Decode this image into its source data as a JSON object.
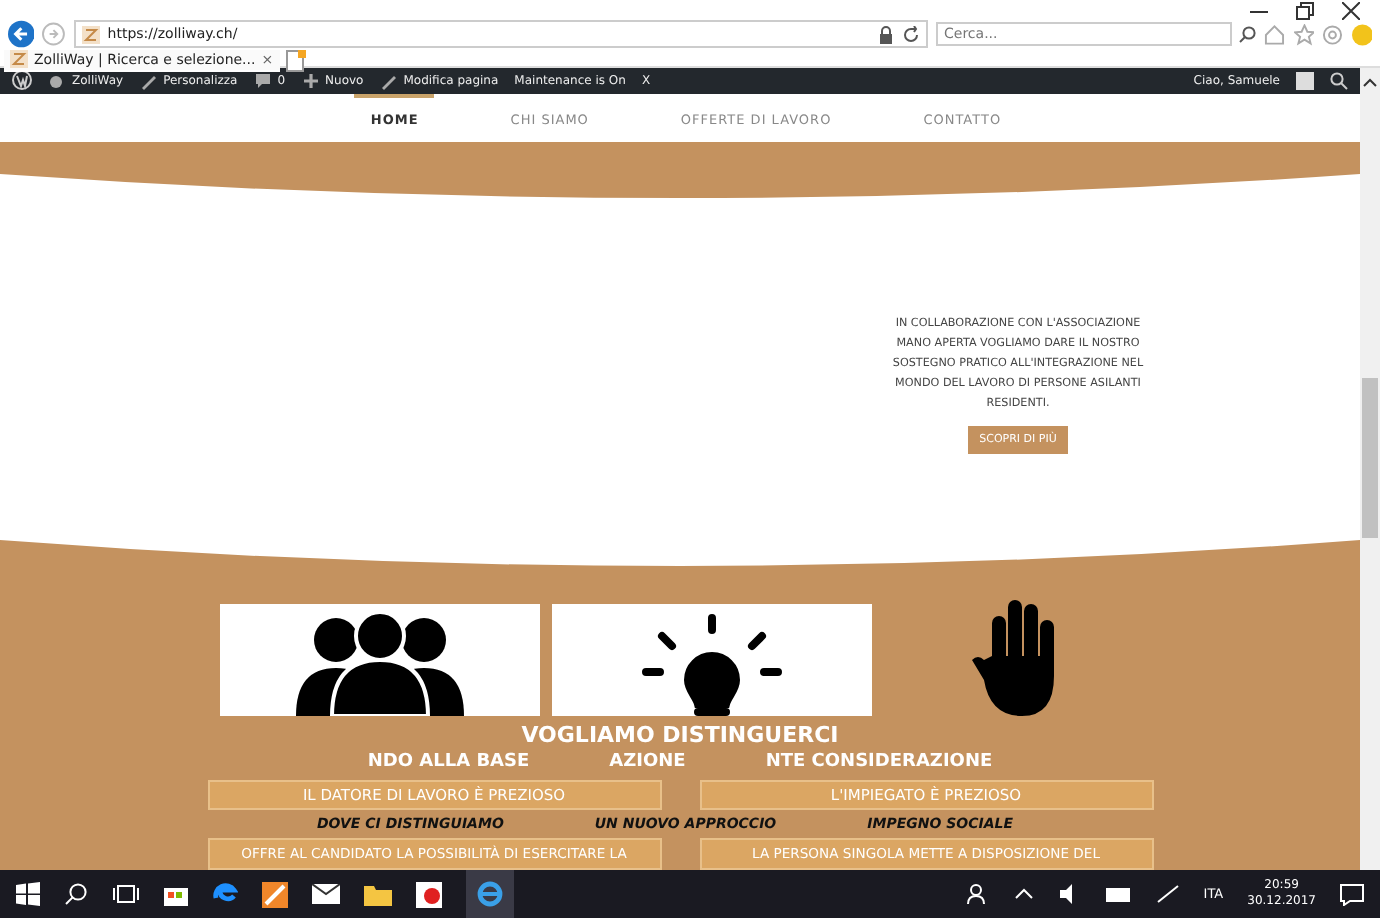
{
  "browser": {
    "address": "https://zolliway.ch/",
    "search": {
      "placeholder": "Cerca..."
    },
    "tabs": [
      {
        "label": "ZolliWay | Ricerca e selezione...",
        "close": "×",
        "selected": true
      }
    ]
  },
  "admin_bar": {
    "items": [
      "ZolliWay",
      "Personalizza",
      "0",
      "Nuovo",
      "Modifica pagina",
      "Maintenance is On",
      "X"
    ],
    "greeting": "Ciao, Samuele"
  },
  "nav": {
    "items": [
      {
        "label": "HOME",
        "selected": true
      },
      {
        "label": "CHI SIAMO",
        "selected": false
      },
      {
        "label": "OFFERTE DI LAVORO",
        "selected": false
      },
      {
        "label": "CONTATTO",
        "selected": false
      }
    ]
  },
  "intro": {
    "text": "IN COLLABORAZIONE CON L'ASSOCIAZIONE MANO APERTA VOGLIAMO DARE IL NOSTRO SOSTEGNO PRATICO ALL'INTEGRAZIONE NEL MONDO DEL LAVORO DI PERSONE ASILANTI RESIDENTI.",
    "button": "SCOPRI DI PIÙ"
  },
  "section": {
    "heading": "VOGLIAMO DISTINGUERCI",
    "subheading": [
      "NDO ALLA BASE",
      "AZIONE",
      "NTE CONSIDERAZIONE"
    ],
    "tags": [
      "IL DATORE DI LAVORO È PREZIOSO",
      "L'IMPIEGATO È PREZIOSO"
    ],
    "titles": [
      "DOVE CI DISTINGUIAMO",
      "UN NUOVO APPROCCIO",
      "IMPEGNO SOCIALE"
    ],
    "boxes": [
      "OFFRE AL CANDIDATO LA POSSIBILITÀ DI ESERCITARE LA",
      "LA PERSONA SINGOLA METTE A DISPOSIZIONE DEL"
    ]
  },
  "taskbar": {
    "language": "ITA",
    "time": "20:59",
    "date": "30.12.2017"
  }
}
